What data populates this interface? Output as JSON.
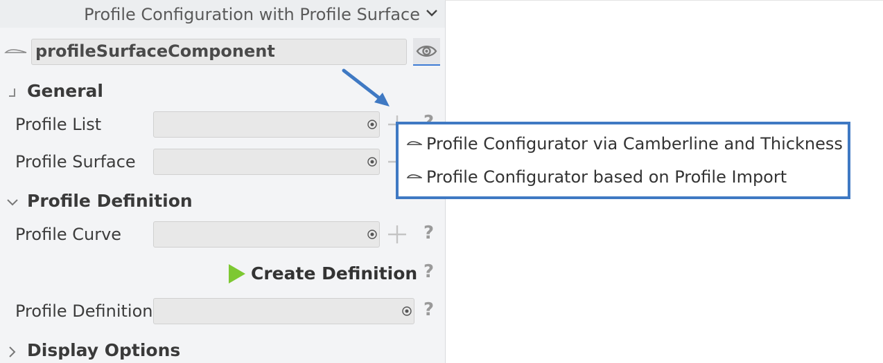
{
  "header": {
    "title": "Profile Configuration with Profile Surface"
  },
  "component": {
    "name": "profileSurfaceComponent"
  },
  "sections": {
    "general": {
      "title": "General",
      "profile_list_label": "Profile List",
      "profile_surface_label": "Profile Surface"
    },
    "profile_definition": {
      "title": "Profile Definition",
      "profile_curve_label": "Profile Curve",
      "create_label": "Create Definition",
      "profile_definition_label": "Profile Definition"
    },
    "display_options": {
      "title": "Display Options"
    }
  },
  "help_glyph": "?",
  "popup": {
    "items": [
      {
        "label": "Profile Configurator via Camberline and Thickness"
      },
      {
        "label": "Profile Configurator based on Profile Import"
      }
    ]
  },
  "colors": {
    "accent": "#3f79c3",
    "play": "#7dc832"
  },
  "icons": {
    "title": "chevron-down-icon",
    "component": "profile-curve-icon",
    "visibility": "eye-icon",
    "general": "collapsed-corner-icon",
    "profile_definition": "chevron-down-icon",
    "display_options": "chevron-right-icon",
    "create": "play-icon"
  }
}
